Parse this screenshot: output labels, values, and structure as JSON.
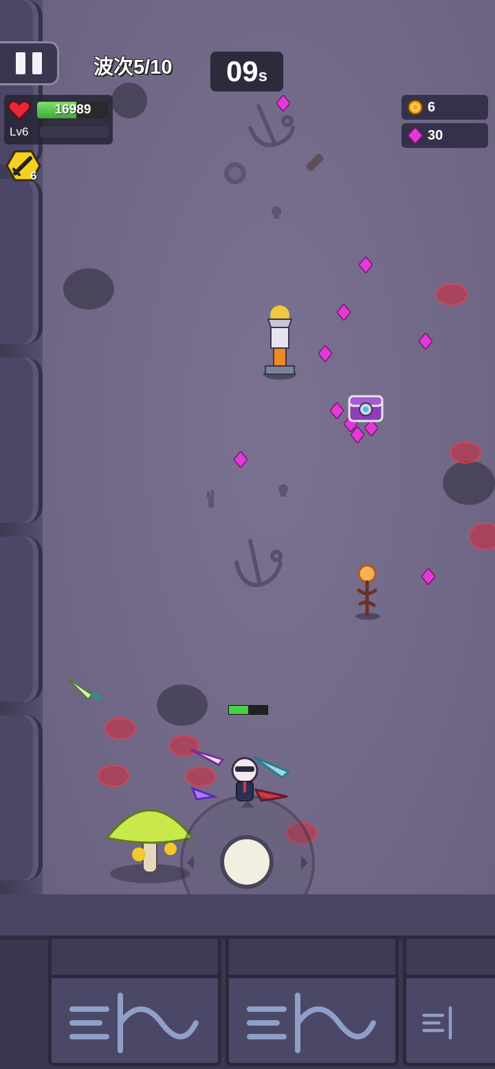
{
  "hud": {
    "pause_label": "",
    "wave_label": "波次5/10",
    "timer_value": "09",
    "timer_unit": "s",
    "hp_value": "16989",
    "hp_fraction": 0.55,
    "level_label": "Lv6",
    "xp_fraction": 0.0,
    "skill_icon": "sword-icon",
    "skill_count": "6",
    "gold_value": "6",
    "gem_value": "30",
    "enemy_hp_fraction": 0.5
  },
  "colors": {
    "gem": "#e23ad8",
    "gold": "#f2a822",
    "blood": "#d6283c",
    "hp_green": "#3daa35"
  }
}
